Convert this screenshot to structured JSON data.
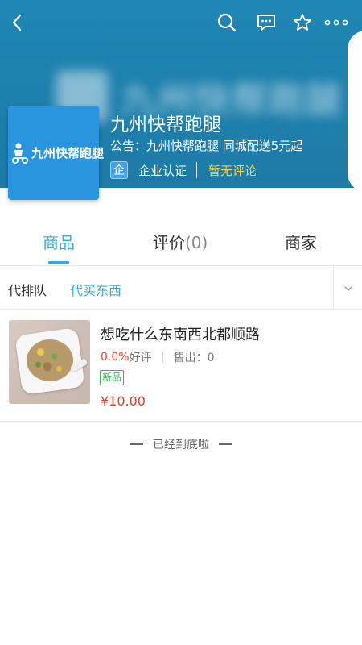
{
  "shop": {
    "watermark_text": "九州快帮跑腿",
    "logo_text": "九州快帮跑腿",
    "name": "九州快帮跑腿",
    "notice": "公告：九州快帮跑腿 同城配送5元起",
    "cert_badge": "企",
    "cert_label": "企业认证",
    "review_status": "暂无评论"
  },
  "topbar_icons": [
    "back-icon",
    "search-icon",
    "chat-icon",
    "star-icon",
    "more-icon"
  ],
  "tabs": {
    "goods": "商品",
    "review": "评价",
    "review_count": "(0)",
    "merchant": "商家"
  },
  "categories": {
    "items": [
      "代排队",
      "代买东西"
    ],
    "active": "代买东西"
  },
  "product": {
    "title": "想吃什么东南西北都顺路",
    "rating": "0.0%",
    "rating_label": "好评",
    "sold": "售出：0",
    "badge": "新品",
    "price": "¥10.00"
  },
  "footer": {
    "end_text": "已经到底啦"
  },
  "colors": {
    "header_bg": "#1f86b3",
    "accent": "#3aa8d8",
    "price_red": "#d8402c",
    "review_yellow": "#f5d34a",
    "badge_green": "#42b05a"
  }
}
